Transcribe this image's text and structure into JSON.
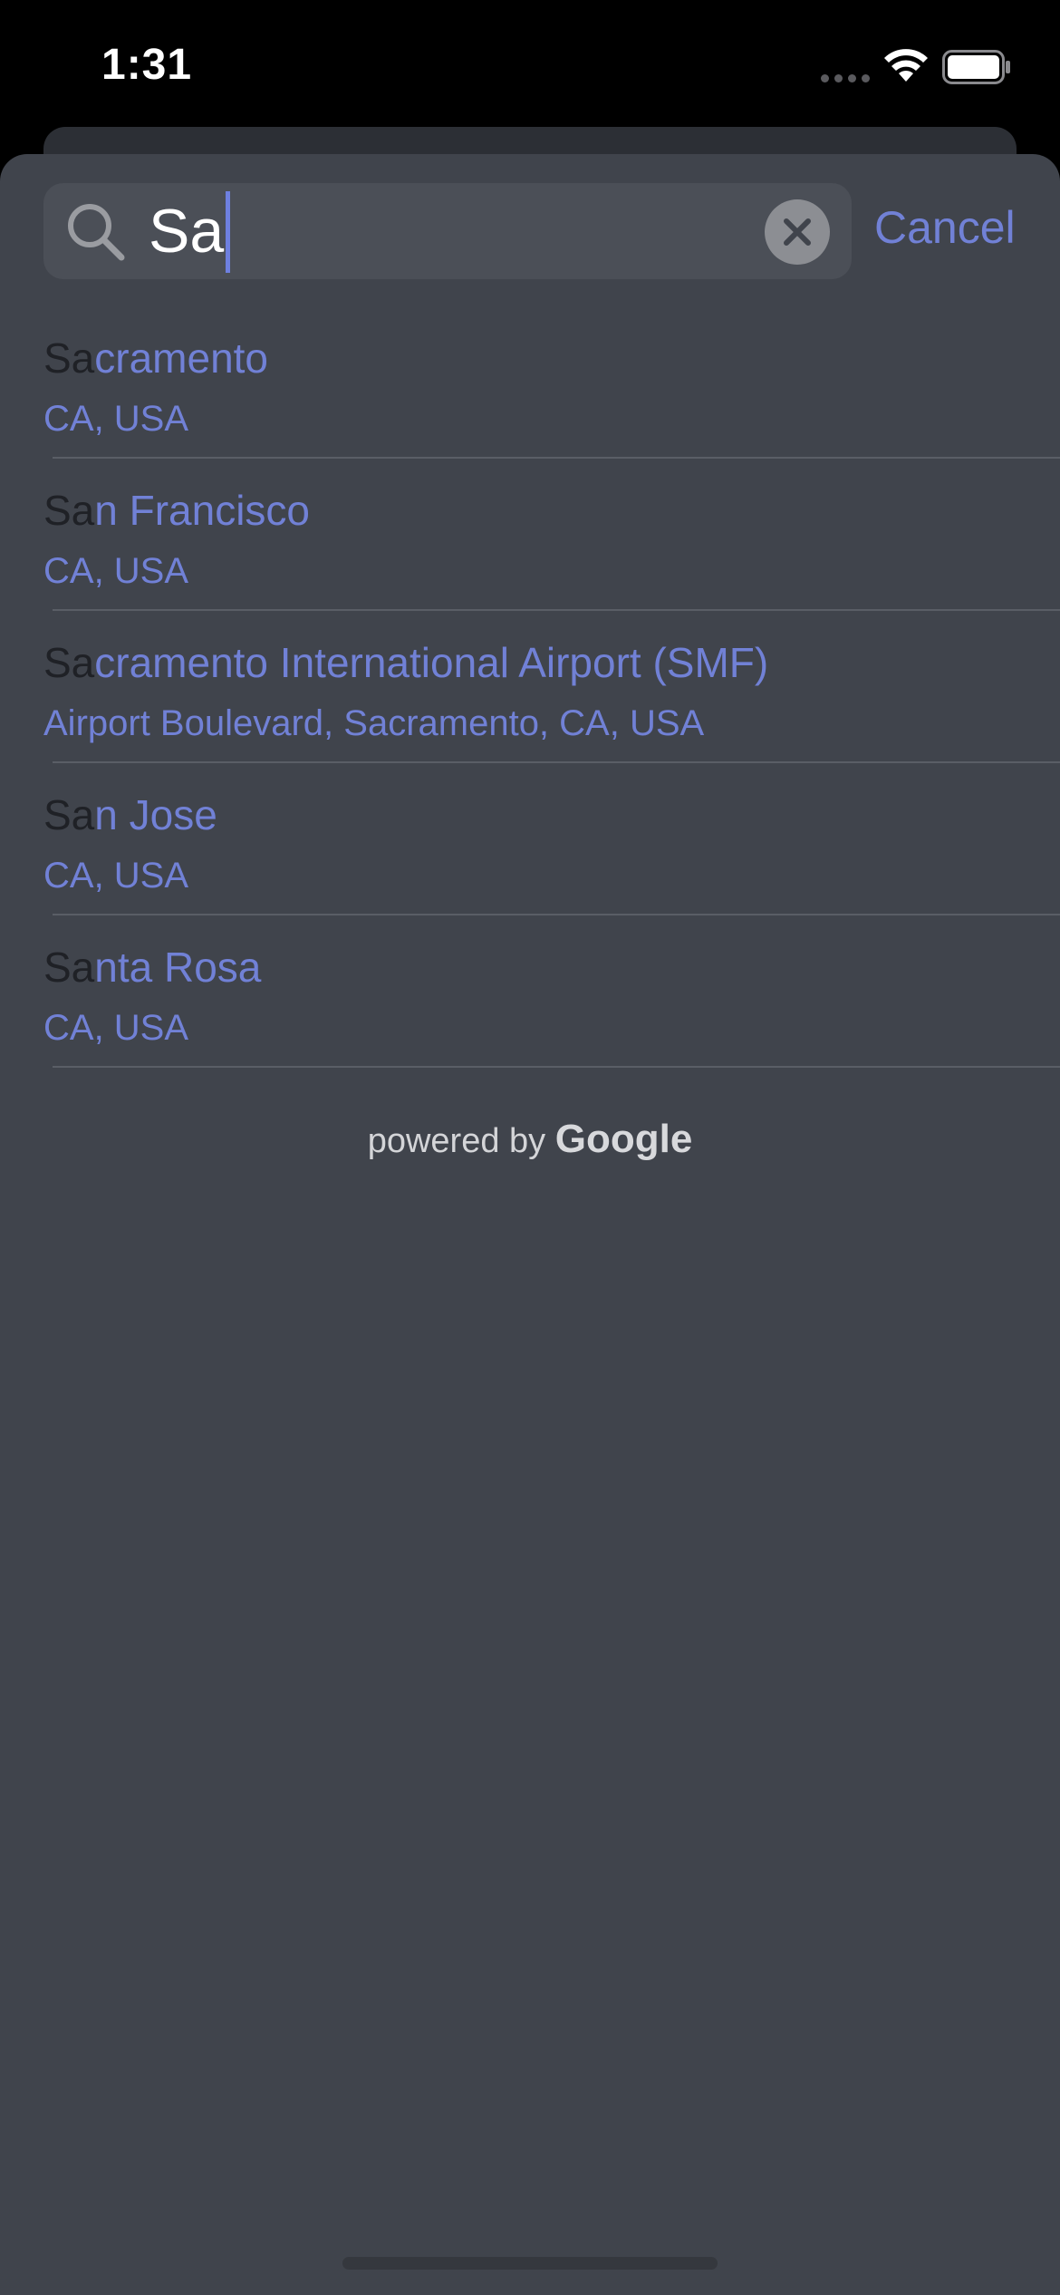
{
  "status_bar": {
    "time": "1:31"
  },
  "search": {
    "query": "Sa",
    "cancel_label": "Cancel"
  },
  "results": [
    {
      "match": "Sa",
      "rest": "cramento",
      "subtitle": "CA, USA"
    },
    {
      "match": "Sa",
      "rest": "n Francisco",
      "subtitle": "CA, USA"
    },
    {
      "match": "Sa",
      "rest": "cramento International Airport (SMF)",
      "subtitle": "Airport Boulevard, Sacramento, CA, USA"
    },
    {
      "match": "Sa",
      "rest": "n Jose",
      "subtitle": "CA, USA"
    },
    {
      "match": "Sa",
      "rest": "nta Rosa",
      "subtitle": "CA, USA"
    }
  ],
  "footer": {
    "powered_by": "powered by",
    "brand": "Google"
  },
  "colors": {
    "accent": "#7181d6",
    "sheet_background": "#40444c",
    "field_background": "#4b4f57"
  }
}
